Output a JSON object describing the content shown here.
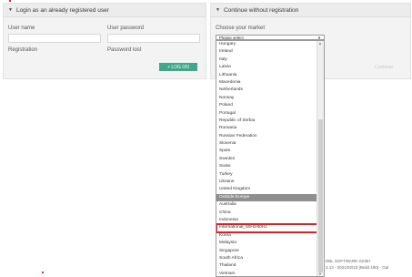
{
  "login": {
    "title": "Login as an already registered user",
    "user_name_label": "User name",
    "password_label": "User password",
    "registration_link": "Registration",
    "password_lost_link": "Password lost",
    "login_button": "+ LOG ON"
  },
  "guest": {
    "title": "Continue without registration",
    "market_label": "Choose your market",
    "select_value": "Please select",
    "continue_button": "Continue",
    "options": [
      "Hungary",
      "Ireland",
      "Italy",
      "Latvia",
      "Lithuania",
      "Macedonia",
      "Netherlands",
      "Norway",
      "Poland",
      "Portugal",
      "Republic of Serbia",
      "Romania",
      "Russian Federation",
      "Slovenia",
      "Spain",
      "Sweden",
      "Swiss",
      "Turkey",
      "Ukraine",
      "United Kingdom",
      "Outside Europe",
      "Australia",
      "China",
      "Indonesia",
      "International_50Hz/60Hz",
      "Korea",
      "Malaysia",
      "Singapore",
      "South Africa",
      "Thailand",
      "Vietnam"
    ],
    "selected_option": "Outside Europe",
    "highlighted_option": "International_50Hz/60Hz"
  },
  "footer": {
    "company": "DBL SOFTWARE GmbH",
    "version": "3.13 - 2021/02/23 (Build 190) - Gal"
  }
}
